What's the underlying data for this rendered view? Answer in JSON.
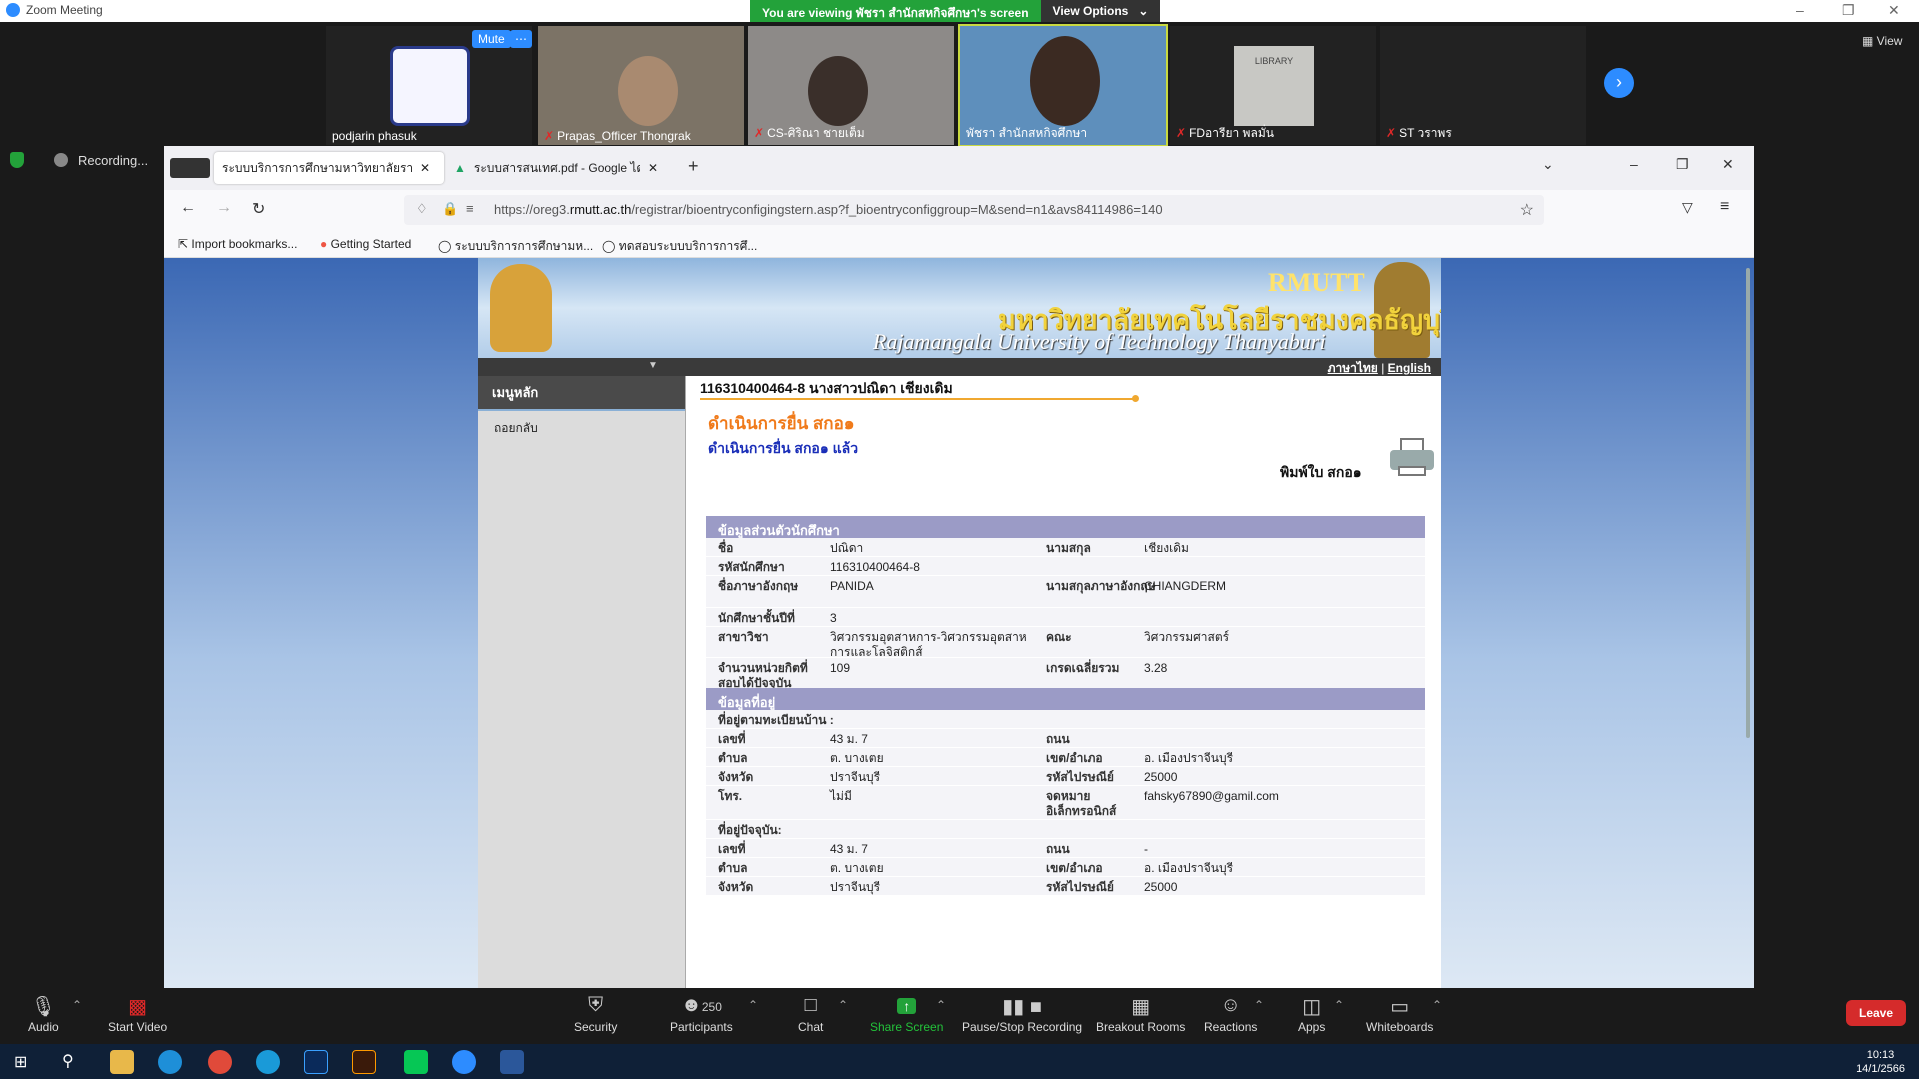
{
  "zoom": {
    "title": "Zoom Meeting",
    "viewing_msg": "You are viewing พัชรา สำนักสหกิจศึกษา's screen",
    "view_options": "View Options",
    "view_label": "View",
    "recording": "Recording...",
    "mute": "Mute",
    "participants": [
      {
        "name": "podjarin phasuk",
        "muted": false
      },
      {
        "name": "Prapas_Officer Thongrak",
        "muted": true
      },
      {
        "name": "CS-ศิริณา ชายเต็ม",
        "muted": true
      },
      {
        "name": "พัชรา สำนักสหกิจศึกษา",
        "muted": false
      },
      {
        "name": "FDอารียา พลมั่น",
        "muted": true
      },
      {
        "name": "ST วราพร",
        "muted": true
      }
    ],
    "library_sign": "LIBRARY",
    "toolbar": {
      "audio": "Audio",
      "start_video": "Start Video",
      "security": "Security",
      "participants": "Participants",
      "participants_count": "250",
      "chat": "Chat",
      "share_screen": "Share Screen",
      "pause_recording": "Pause/Stop Recording",
      "breakout": "Breakout Rooms",
      "reactions": "Reactions",
      "apps": "Apps",
      "whiteboards": "Whiteboards",
      "leave": "Leave"
    }
  },
  "browser": {
    "tabs": [
      {
        "label": "ระบบบริการการศึกษามหาวิทยาลัยราชม"
      },
      {
        "label": "ระบบสารสนเทศ.pdf - Google ไดร"
      }
    ],
    "url_prefix": "https://oreg3.",
    "url_domain": "rmutt.ac.th",
    "url_rest": "/registrar/bioentryconfigingstern.asp?f_bioentryconfiggroup=M&send=n1&avs84114986=140",
    "bookmarks": [
      "Import bookmarks...",
      "Getting Started",
      "ระบบบริการการศึกษามห...",
      "ทดสอบระบบบริการการศึ..."
    ]
  },
  "site": {
    "banner_thai": "มหาวิทยาลัยเทคโนโลยีราชมงคลธัญบุรี",
    "banner_en": "Rajamangala University of Technology Thanyaburi",
    "banner_rm": "RMUTT",
    "lang_th": "ภาษาไทย",
    "lang_sep": "|",
    "lang_en": "English",
    "menu_header": "เมนูหลัก",
    "menu_item": "ถอยกลับ",
    "student_heading": "116310400464-8 นางสาวปณิดา เชียงเดิม",
    "page_title": "ดำเนินการยื่น สกอ๑",
    "status_text": "ดำเนินการยื่น สกอ๑ แล้ว",
    "print_label": "พิมพ์ใบ สกอ๑",
    "sec_personal": "ข้อมูลส่วนตัวนักศึกษา",
    "sec_address": "ข้อมูลที่อยู่",
    "personal": [
      {
        "l1": "ชื่อ",
        "v1": "ปณิดา",
        "l2": "นามสกุล",
        "v2": "เชียงเดิม"
      },
      {
        "l1": "รหัสนักศึกษา",
        "v1": "116310400464-8",
        "l2": "",
        "v2": ""
      },
      {
        "l1": "ชื่อภาษาอังกฤษ",
        "v1": "PANIDA",
        "l2": "นามสกุลภาษาอังกฤษ",
        "v2": "CHIANGDERM"
      },
      {
        "l1": "นักศึกษาชั้นปีที่",
        "v1": "3",
        "l2": "",
        "v2": ""
      },
      {
        "l1": "สาขาวิชา",
        "v1": "วิศวกรรมอุตสาหการ-วิศวกรรมอุตสาหการและโลจิสติกส์",
        "l2": "คณะ",
        "v2": "วิศวกรรมศาสตร์"
      },
      {
        "l1": "จำนวนหน่วยกิตที่สอบได้ปัจจุบัน",
        "v1": "109",
        "l2": "เกรดเฉลี่ยรวม",
        "v2": "3.28"
      }
    ],
    "addr_reg_title": "ที่อยู่ตามทะเบียนบ้าน :",
    "addr_reg": [
      {
        "l1": "เลขที่",
        "v1": "43 ม. 7",
        "l2": "ถนน",
        "v2": ""
      },
      {
        "l1": "ตำบล",
        "v1": "ต. บางเตย",
        "l2": "เขต/อำเภอ",
        "v2": "อ. เมืองปราจีนบุรี"
      },
      {
        "l1": "จังหวัด",
        "v1": "ปราจีนบุรี",
        "l2": "รหัสไปรษณีย์",
        "v2": "25000"
      },
      {
        "l1": "โทร.",
        "v1": "ไม่มี",
        "l2": "จดหมายอิเล็กทรอนิกส์",
        "v2": "fahsky67890@gamil.com"
      }
    ],
    "addr_cur_title": "ที่อยู่ปัจจุบัน:",
    "addr_cur": [
      {
        "l1": "เลขที่",
        "v1": "43 ม. 7",
        "l2": "ถนน",
        "v2": "-"
      },
      {
        "l1": "ตำบล",
        "v1": "ต. บางเตย",
        "l2": "เขต/อำเภอ",
        "v2": "อ. เมืองปราจีนบุรี"
      },
      {
        "l1": "จังหวัด",
        "v1": "ปราจีนบุรี",
        "l2": "รหัสไปรษณีย์",
        "v2": "25000"
      }
    ]
  },
  "taskbar": {
    "time": "10:13",
    "date": "14/1/2566"
  }
}
